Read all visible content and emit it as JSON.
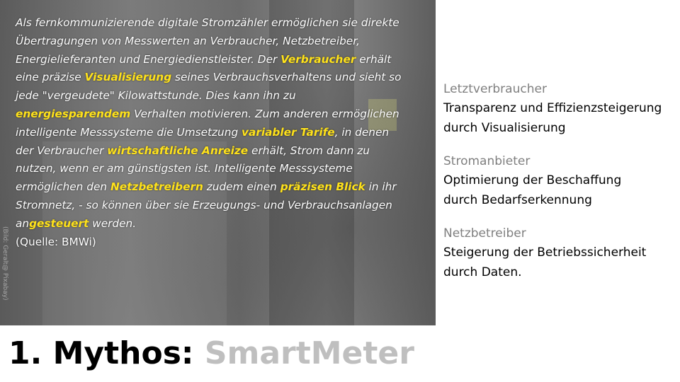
{
  "photo_credit": "(Bild: Geralt@ Pixabay)",
  "paragraph": [
    {
      "t": "Als fernkommunizierende digitale Stromzähler ermöglichen sie direkte Übertragungen von Messwerten an Verbraucher, Netzbetreiber, Energielieferanten und Energiedienstleister. Der ",
      "hl": false
    },
    {
      "t": "Verbraucher",
      "hl": true
    },
    {
      "t": "  erhält eine präzise ",
      "hl": false
    },
    {
      "t": "Visualisierung",
      "hl": true
    },
    {
      "t": "  seines Verbrauchsverhaltens und sieht so jede \"vergeudete\" Kilowattstunde. Dies kann ihn zu ",
      "hl": false
    },
    {
      "t": "energiesparendem",
      "hl": true
    },
    {
      "t": " Verhalten motivieren. Zum anderen ermöglichen intelligente Messsysteme die Umsetzung ",
      "hl": false
    },
    {
      "t": "variabler Tarife",
      "hl": true
    },
    {
      "t": ", in denen der Verbraucher ",
      "hl": false
    },
    {
      "t": "wirtschaftliche  Anreize",
      "hl": true
    },
    {
      "t": "  erhält, Strom dann zu nutzen, wenn er am günstigsten ist. Intelligente Messsysteme ermöglichen den ",
      "hl": false
    },
    {
      "t": "Netzbetreibern",
      "hl": true
    },
    {
      "t": "  zudem einen ",
      "hl": false
    },
    {
      "t": "präzisen  Blick",
      "hl": true
    },
    {
      "t": " in ihr Stromnetz, - so können über sie Erzeugungs- und Verbrauchsanlagen an",
      "hl": false
    },
    {
      "t": "gesteuert",
      "hl": true
    },
    {
      "t": "  werden.",
      "hl": false
    }
  ],
  "source": "(Quelle: BMWi)",
  "groups": [
    {
      "label": "Letztverbraucher",
      "desc1": "Transparenz und Effizienzsteigerung",
      "desc2": "durch Visualisierung"
    },
    {
      "label": "Stromanbieter",
      "desc1": "Optimierung der Beschaffung",
      "desc2": "durch Bedarfserkennung"
    },
    {
      "label": "Netzbetreiber",
      "desc1": "Steigerung der Betriebssicherheit",
      "desc2": "durch Daten."
    }
  ],
  "title": {
    "part1": "1. Mythos: ",
    "part2": "SmartMeter"
  },
  "colors": {
    "highlight": "#ffe21a",
    "label_gray": "#7f7f7f",
    "title_gray": "#bfbfbf"
  }
}
